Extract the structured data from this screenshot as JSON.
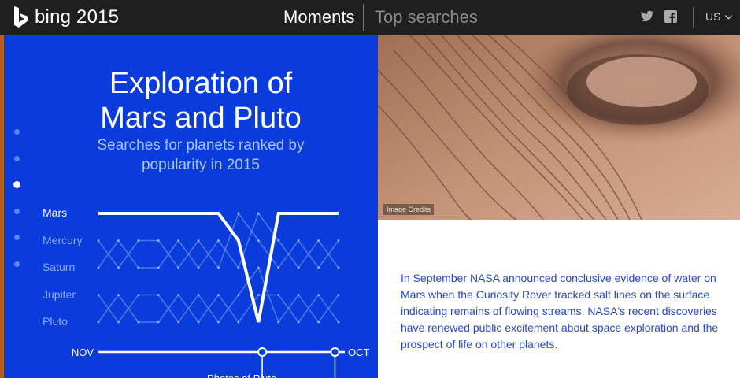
{
  "header": {
    "logo_text": "bing 2015",
    "nav": [
      "Moments",
      "Top searches"
    ],
    "region": "US",
    "social_icons": [
      "twitter-icon",
      "facebook-icon"
    ]
  },
  "panel": {
    "title_line1": "Exploration of",
    "title_line2": "Mars and Pluto",
    "subtitle_line1": "Searches for planets ranked by",
    "subtitle_line2": "popularity in 2015",
    "pager_count": 6,
    "pager_active_index": 2
  },
  "chart_data": {
    "type": "line",
    "title": "Exploration of Mars and Pluto",
    "subtitle": "Searches for planets ranked by popularity in 2015",
    "ranks": [
      "Mars",
      "Mercury",
      "Saturn",
      "Jupiter",
      "Pluto"
    ],
    "highlighted_series": "Mars",
    "axis_start": "NOV",
    "axis_end": "OCT",
    "timeline_annotation": "Photos of Pluto",
    "series": [
      {
        "name": "Mars",
        "values": [
          1,
          1,
          1,
          1,
          1,
          1,
          1,
          2,
          5,
          1,
          1,
          1,
          1
        ]
      },
      {
        "name": "Mercury",
        "values": [
          2,
          3,
          2,
          2,
          3,
          2,
          3,
          1,
          2,
          3,
          2,
          3,
          2
        ]
      },
      {
        "name": "Saturn",
        "values": [
          3,
          2,
          3,
          3,
          2,
          3,
          2,
          3,
          1,
          2,
          3,
          2,
          3
        ]
      },
      {
        "name": "Jupiter",
        "values": [
          4,
          5,
          4,
          4,
          5,
          4,
          5,
          4,
          3,
          5,
          4,
          5,
          4
        ]
      },
      {
        "name": "Pluto",
        "values": [
          5,
          4,
          5,
          5,
          4,
          5,
          4,
          5,
          4,
          4,
          5,
          4,
          5
        ]
      }
    ]
  },
  "photo": {
    "credits": "Image Credits"
  },
  "article": {
    "text": "In September NASA announced conclusive evidence of water on Mars when the Curiosity Rover tracked salt lines on the surface indicating remains of flowing streams. NASA's recent discoveries have renewed public excitement about space exploration and the prospect of life on other planets."
  },
  "colors": {
    "panel_blue": "#0a3cdc",
    "article_text": "#2548c6",
    "topbar": "#1f1f1f"
  }
}
